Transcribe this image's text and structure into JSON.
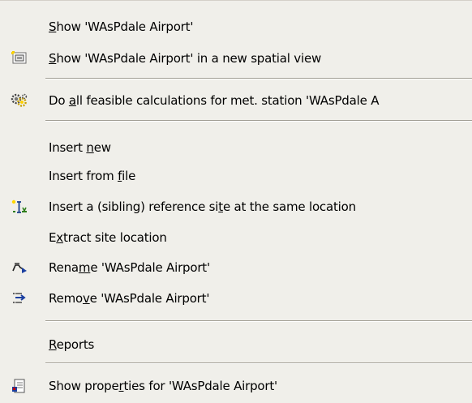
{
  "menu": {
    "items": [
      {
        "pre": "",
        "ul": "S",
        "post": "how 'WAsPdale Airport'",
        "icon": ""
      },
      {
        "pre": "",
        "ul": "S",
        "post": "how 'WAsPdale Airport' in a new spatial view",
        "icon": "spatial-view-icon"
      },
      {
        "pre": "Do ",
        "ul": "a",
        "post": "ll feasible calculations for met. station 'WAsPdale A",
        "icon": "gears-icon"
      },
      {
        "pre": "Insert ",
        "ul": "n",
        "post": "ew",
        "icon": ""
      },
      {
        "pre": "Insert from ",
        "ul": "f",
        "post": "ile",
        "icon": ""
      },
      {
        "pre": "Insert a (sibling) reference si",
        "ul": "t",
        "post": "e at the same location",
        "icon": "reference-site-icon"
      },
      {
        "pre": "E",
        "ul": "x",
        "post": "tract site location",
        "icon": ""
      },
      {
        "pre": "Rena",
        "ul": "m",
        "post": "e 'WAsPdale Airport'",
        "icon": "rename-icon"
      },
      {
        "pre": "Remo",
        "ul": "v",
        "post": "e 'WAsPdale Airport'",
        "icon": "remove-icon"
      },
      {
        "pre": "",
        "ul": "R",
        "post": "eports",
        "icon": ""
      },
      {
        "pre": "Show prope",
        "ul": "r",
        "post": "ties for 'WAsPdale Airport'",
        "icon": "properties-icon"
      }
    ]
  }
}
